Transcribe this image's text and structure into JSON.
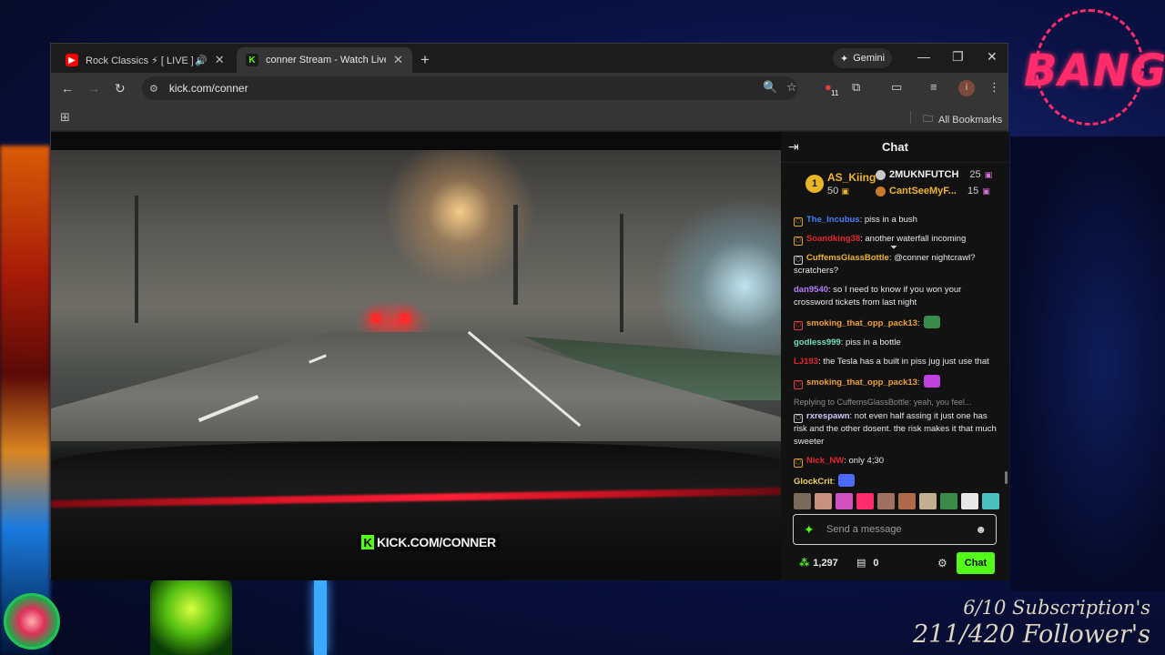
{
  "browser": {
    "tabs": [
      {
        "title": "Rock Classics ⚡ [ LIVE ] Tim",
        "active": false
      },
      {
        "title": "conner Stream - Watch Live on",
        "active": true
      }
    ],
    "new_tab_symbol": "+",
    "gemini_label": "Gemini",
    "url": "kick.com/conner",
    "extension_badge": "11",
    "avatar_initial": "i",
    "bookmarks_label": "All Bookmarks"
  },
  "video": {
    "watermark": "KICK.COM/CONNER"
  },
  "chat": {
    "title": "Chat",
    "leaderboard": {
      "first": {
        "rank": "1",
        "name": "AS_Kiing",
        "count": "50"
      },
      "second": {
        "name": "2MUKNFUTCH",
        "count": "25"
      },
      "third": {
        "name": "CantSeeMyF...",
        "count": "15"
      }
    },
    "messages": [
      {
        "user": "The_Incubus",
        "text": ": piss in a bush",
        "user_color": "#4a7dff",
        "badge": ""
      },
      {
        "user": "Soandking38",
        "text": ": another waterfall incoming",
        "user_color": "#e8242e",
        "badge": ""
      },
      {
        "user": "CuffemsGlassBottle",
        "text": ": @conner nightcrawl? scratchers?",
        "user_color": "#f0b429",
        "badge": ""
      },
      {
        "user": "dan9540",
        "text": ": so I need to know if you won your crossword tickets from last night",
        "user_color": "#b57dff",
        "badge": ""
      },
      {
        "user": "smoking_that_opp_pack13",
        "text": ":",
        "user_color": "#f0a030",
        "badge": "",
        "emote": "#3a8a4a"
      },
      {
        "user": "godless999",
        "text": ": piss in a bottle",
        "user_color": "#6fe0c0",
        "badge": ""
      },
      {
        "user": "LJ193",
        "text": ": the Tesla has a built in piss jug just use that",
        "user_color": "#e8242e",
        "badge": ""
      },
      {
        "user": "smoking_that_opp_pack13",
        "text": ":",
        "user_color": "#f0a030",
        "badge": "",
        "emote": "#c040e0"
      },
      {
        "user": "rxrespawn",
        "text": ": not even half assing it just one has risk and the other dosent. the risk makes it that much sweeter",
        "user_color": "#d6c6ff",
        "badge": "",
        "reply": "Replying to CuffemsGlassBottle: yeah, you feel..."
      },
      {
        "user": "Nick_NW",
        "text": ": only 4;30",
        "user_color": "#e8242e",
        "badge": ""
      },
      {
        "user": "GlockCrit",
        "text": ":",
        "user_color": "#f0d060",
        "badge": "",
        "emote": "#4a6aff"
      }
    ],
    "input_placeholder": "Send a message",
    "points": "1,297",
    "store_count": "0",
    "chat_button": "Chat"
  },
  "overlay": {
    "logo_text": "BANG",
    "subscriptions": "6/10 Subscription's",
    "followers": "211/420 Follower's"
  },
  "colors": {
    "kick_green": "#53fc18",
    "bang_pink": "#ff2b6a"
  }
}
